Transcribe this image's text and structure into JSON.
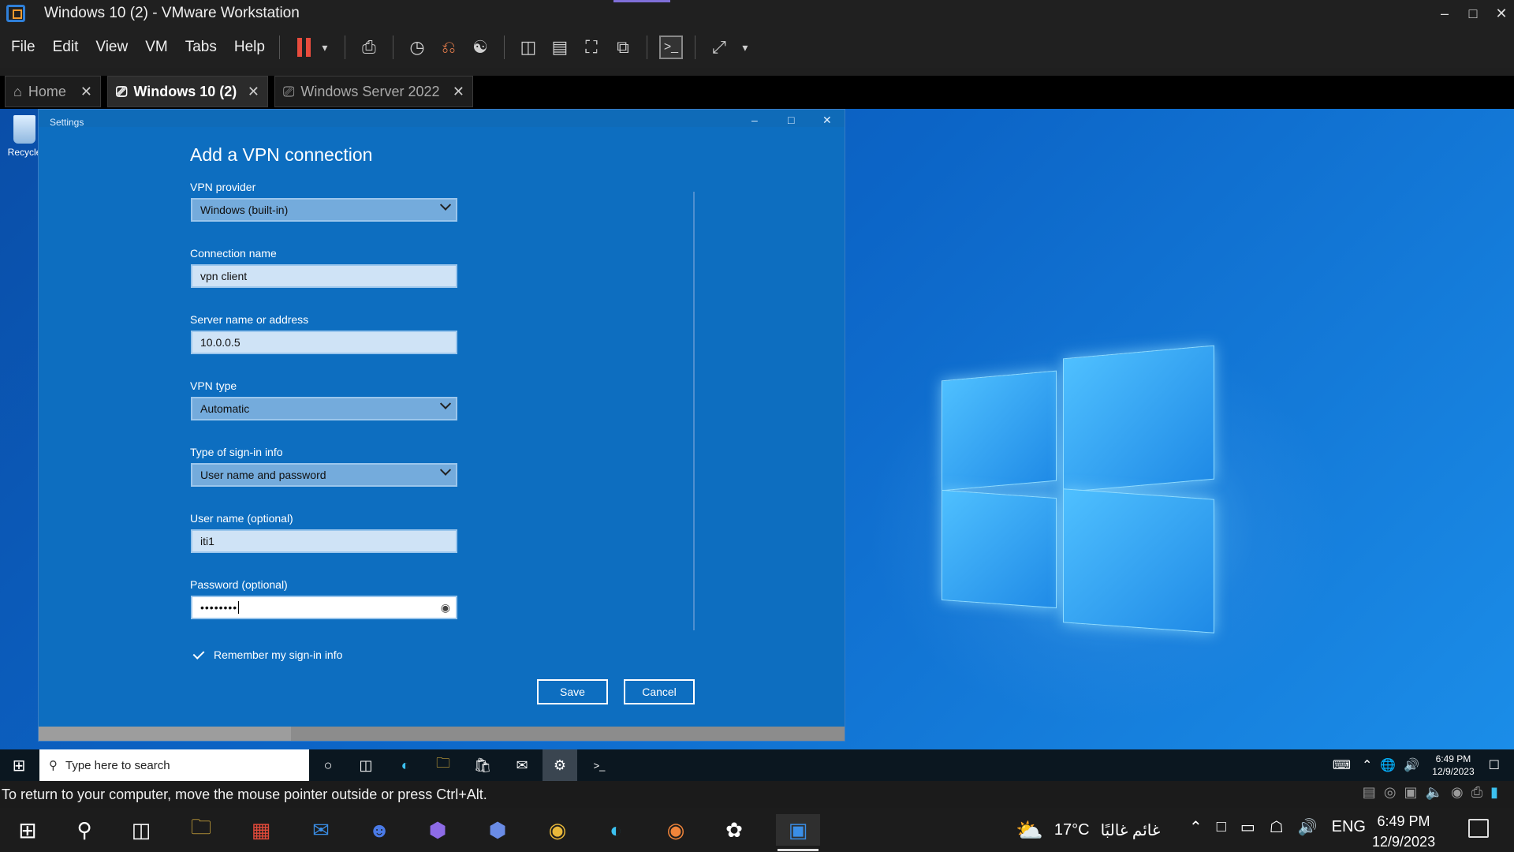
{
  "window": {
    "title": "Windows 10 (2) - VMware Workstation"
  },
  "menu": [
    "File",
    "Edit",
    "View",
    "VM",
    "Tabs",
    "Help"
  ],
  "tabs": [
    {
      "label": "Home",
      "active": false
    },
    {
      "label": "Windows 10 (2)",
      "active": true
    },
    {
      "label": "Windows Server 2022",
      "active": false
    }
  ],
  "desktop": {
    "recycle_label": "Recycle"
  },
  "settings": {
    "window_title": "Settings",
    "heading": "Add a VPN connection",
    "fields": {
      "provider": {
        "label": "VPN provider",
        "value": "Windows (built-in)"
      },
      "connection_name": {
        "label": "Connection name",
        "value": "vpn client"
      },
      "server": {
        "label": "Server name or address",
        "value": "10.0.0.5"
      },
      "vpn_type": {
        "label": "VPN type",
        "value": "Automatic"
      },
      "signin_type": {
        "label": "Type of sign-in info",
        "value": "User name and password"
      },
      "username": {
        "label": "User name (optional)",
        "value": "iti1"
      },
      "password": {
        "label": "Password (optional)",
        "value": "••••••••"
      }
    },
    "remember": {
      "label": "Remember my sign-in info",
      "checked": true
    },
    "save_label": "Save",
    "cancel_label": "Cancel"
  },
  "guest_taskbar": {
    "search_placeholder": "Type here to search",
    "time": "6:49 PM",
    "date": "12/9/2023"
  },
  "statusbar": {
    "message": "To return to your computer, move the mouse pointer outside or press Ctrl+Alt."
  },
  "host_taskbar": {
    "weather_temp": "17°C",
    "weather_text": "غائم غالبًا",
    "language": "ENG",
    "time": "6:49 PM",
    "date": "12/9/2023"
  },
  "colors": {
    "settings_bg": "#0d6ec0",
    "desktop_blue": "#0c65c7",
    "pause_red": "#e84c3d"
  }
}
